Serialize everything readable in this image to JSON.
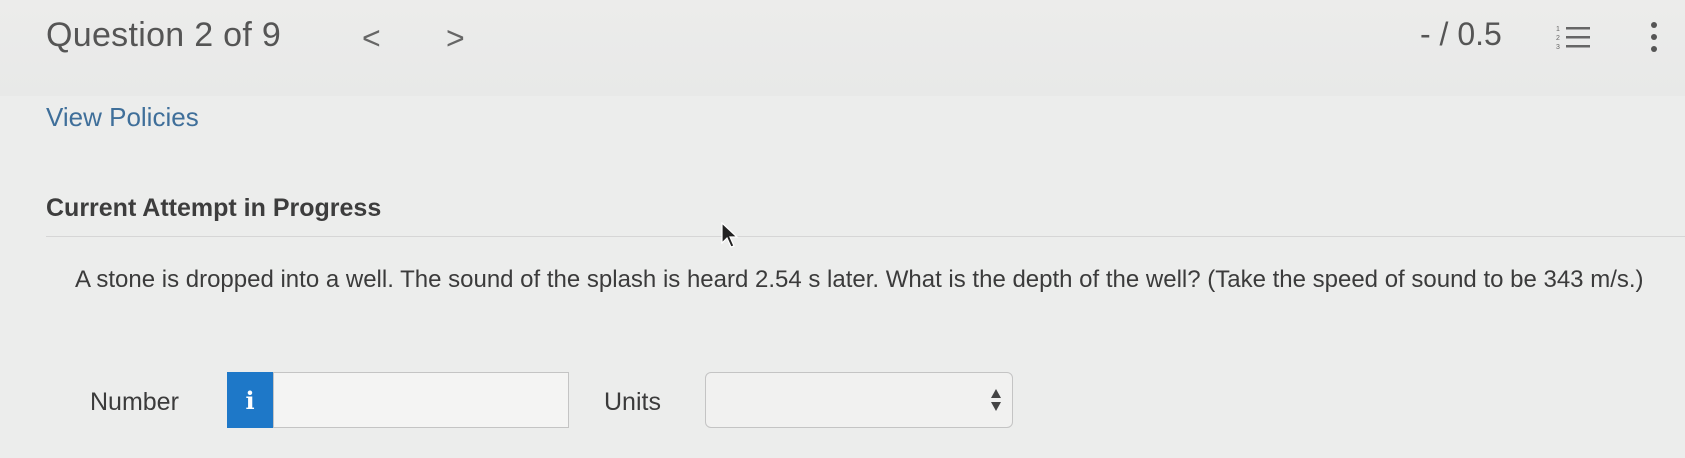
{
  "header": {
    "title": "Question 2 of 9",
    "prev_label": "<",
    "next_label": ">",
    "score": "- / 0.5"
  },
  "links": {
    "policies": "View Policies"
  },
  "attempt": {
    "status": "Current Attempt in Progress"
  },
  "question": {
    "text": "A stone is dropped into a well. The sound of the splash is heard 2.54 s later. What is the depth of the well? (Take the speed of sound to be 343 m/s.)"
  },
  "answer": {
    "number_label": "Number",
    "info_label": "i",
    "number_value": "",
    "units_label": "Units",
    "units_value": ""
  },
  "colors": {
    "link": "#3f6f9a",
    "info_button": "#1e78c8"
  },
  "icons": {
    "list": "numbered-list-icon",
    "more": "vertical-ellipsis-icon"
  }
}
